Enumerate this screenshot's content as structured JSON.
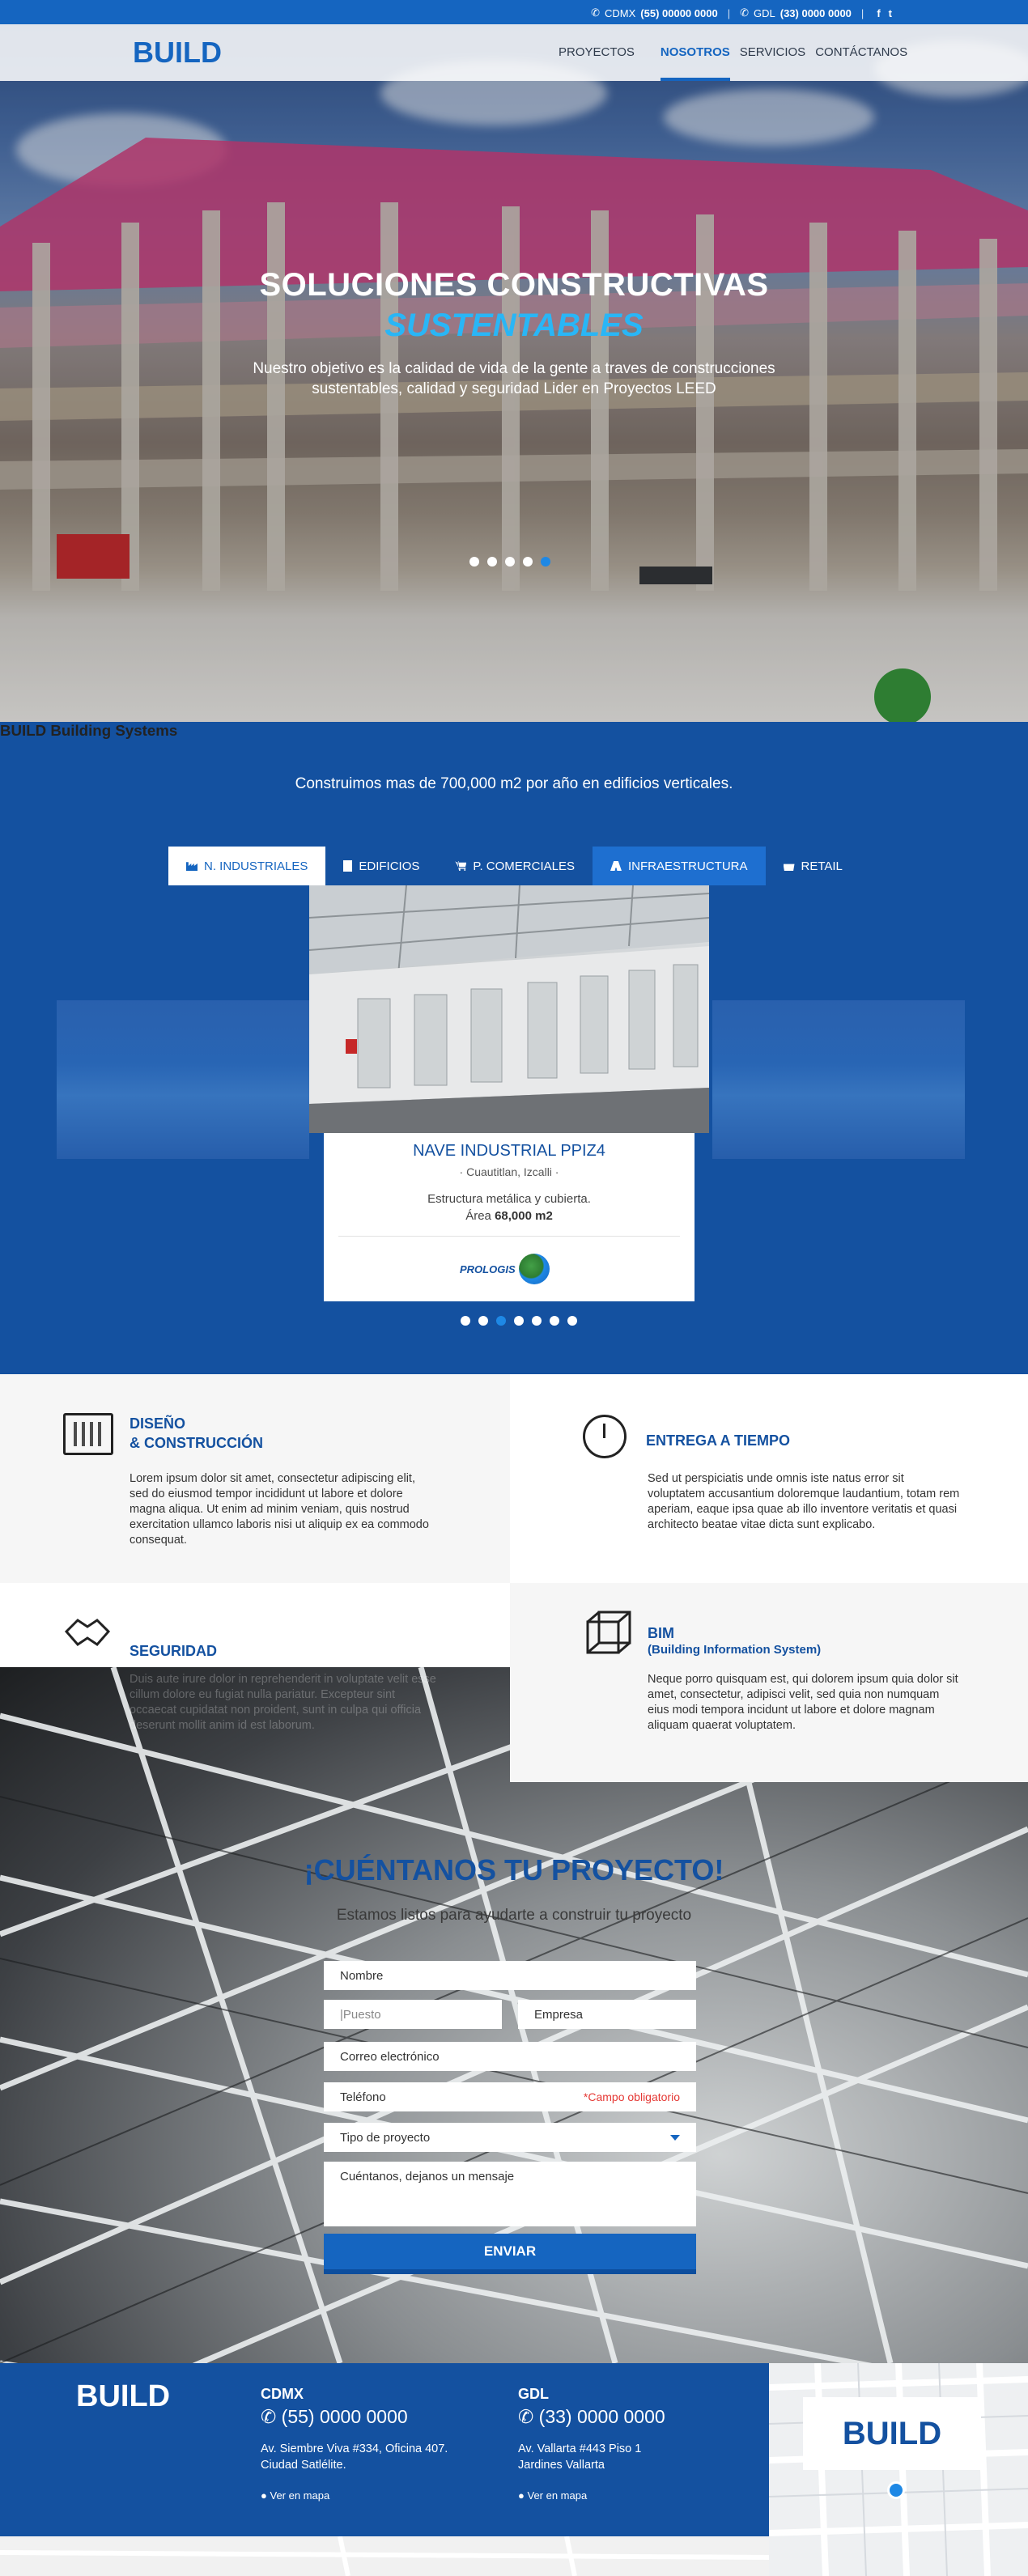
{
  "topbar": {
    "cdmx_label": "CDMX",
    "cdmx_phone": "(55) 00000 0000",
    "gdl_label": "GDL",
    "gdl_phone": "(33) 0000 0000",
    "separator": "|",
    "facebook": "f",
    "twitter": "t"
  },
  "header": {
    "logo": "BUILD",
    "nav": [
      {
        "label": "PROYECTOS"
      },
      {
        "label": "NOSOTROS"
      },
      {
        "label": "SERVICIOS"
      },
      {
        "label": "CONTÁCTANOS"
      }
    ]
  },
  "hero": {
    "title": "SOLUCIONES CONSTRUCTIVAS",
    "subtitle": "SUSTENTABLES",
    "text": "Nuestro objetivo es la calidad de vida de la gente a traves de construcciones sustentables, calidad y seguridad Lider en Proyectos LEED",
    "slides": 5,
    "active_slide": 5
  },
  "systems": {
    "title": "BUILD  Building Systems",
    "subtitle": "Construimos mas de 700,000 m2 por año en edificios verticales.",
    "tabs": [
      {
        "label": "N. INDUSTRIALES",
        "icon": "factory-icon"
      },
      {
        "label": "EDIFICIOS",
        "icon": "building-icon"
      },
      {
        "label": "P. COMERCIALES",
        "icon": "cart-icon"
      },
      {
        "label": "INFRAESTRUCTURA",
        "icon": "road-icon"
      },
      {
        "label": "RETAIL",
        "icon": "shopping-bag-icon"
      }
    ],
    "card": {
      "title": "NAVE INDUSTRIAL PPIZ4",
      "location": "· Cuautitlan, Izcalli ·",
      "description": "Estructura metálica y cubierta.",
      "area_label": "Área",
      "area_value": "68,000 m2",
      "client_logo": "PROLOGIS"
    },
    "slides": 7,
    "active_slide": 3
  },
  "features": [
    {
      "title_line1": "DISEÑO",
      "title_line2": "& CONSTRUCCIÓN",
      "icon": "building-plan-icon",
      "text": "Lorem ipsum dolor sit amet, consectetur adipiscing elit, sed do eiusmod tempor incididunt ut labore et dolore magna aliqua. Ut enim ad minim veniam, quis nostrud exercitation ullamco laboris nisi ut aliquip ex ea commodo consequat."
    },
    {
      "title_line1": "ENTREGA A TIEMPO",
      "title_line2": "",
      "icon": "stopwatch-icon",
      "text": "Sed ut perspiciatis unde omnis iste natus error sit voluptatem accusantium doloremque laudantium, totam rem aperiam, eaque ipsa quae ab illo inventore veritatis et quasi architecto beatae vitae dicta sunt explicabo."
    },
    {
      "title_line1": "SEGURIDAD",
      "title_line2": "",
      "icon": "handshake-icon",
      "text": "Duis aute irure dolor in reprehenderit in voluptate velit esse cillum dolore eu fugiat nulla pariatur. Excepteur sint occaecat cupidatat non proident, sunt in culpa qui officia deserunt mollit anim id est laborum."
    },
    {
      "title_line1": "BIM",
      "title_line2": "(Building Information System)",
      "icon": "cube-icon",
      "text": "Neque porro quisquam est, qui dolorem ipsum quia dolor sit amet, consectetur, adipisci velit, sed quia non numquam eius modi tempora incidunt ut labore et dolore magnam aliquam quaerat voluptatem."
    }
  ],
  "contact": {
    "title": "¡CUÉNTANOS TU PROYECTO!",
    "subtitle": "Estamos listos para ayudarte a construir tu proyecto",
    "fields": {
      "name": "Nombre",
      "position": "|Puesto",
      "company": "Empresa",
      "email": "Correo electrónico",
      "phone": "Teléfono",
      "required_note": "*Campo obligatorio",
      "project_type": "Tipo de proyecto",
      "message": "Cuéntanos, dejanos un mensaje"
    },
    "submit": "ENVIAR"
  },
  "footer": {
    "logo": "BUILD",
    "offices": [
      {
        "city": "CDMX",
        "phone": "(55) 0000 0000",
        "address_line1": "Av. Siembre Viva #334, Oficina 407.",
        "address_line2": "Ciudad Satlélite.",
        "map_link": "Ver en mapa"
      },
      {
        "city": "GDL",
        "phone": "(33) 0000 0000",
        "address_line1": "Av. Vallarta #443 Piso 1",
        "address_line2": "Jardines Vallarta",
        "map_link": "Ver en mapa"
      }
    ],
    "map_logo": "BUILD"
  },
  "colors": {
    "brand_blue": "#1451a0",
    "accent_blue": "#1565c0",
    "cyan": "#29b6f6",
    "required_red": "#e53935"
  }
}
